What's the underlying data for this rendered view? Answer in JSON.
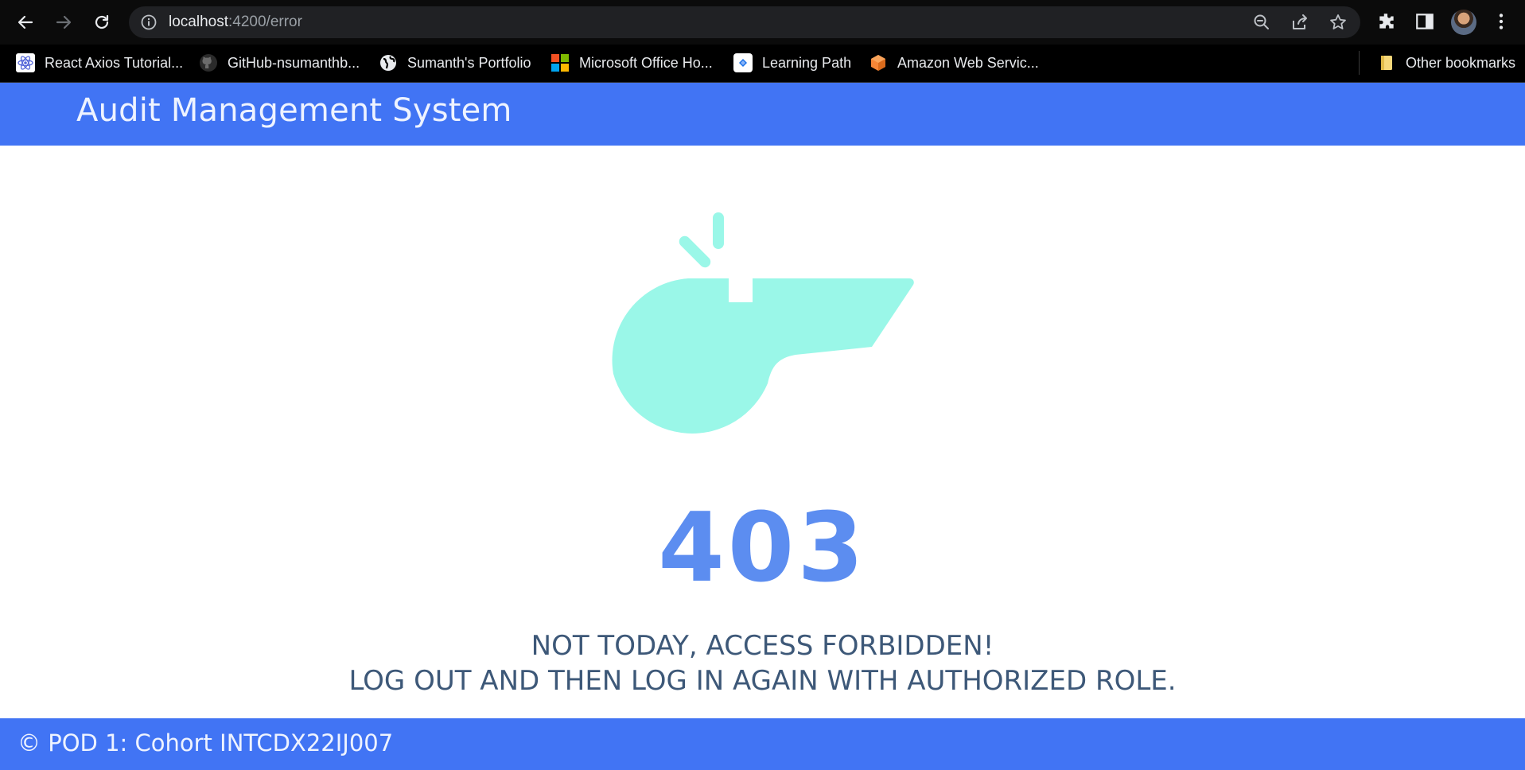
{
  "browser": {
    "url_host": "localhost",
    "url_path": ":4200/error",
    "bookmarks": [
      {
        "label": "React Axios Tutorial...",
        "icon": "react-icon"
      },
      {
        "label": "GitHub-nsumanthb...",
        "icon": "github-icon"
      },
      {
        "label": "Sumanth's Portfolio",
        "icon": "globe-icon"
      },
      {
        "label": "Microsoft Office Ho...",
        "icon": "microsoft-icon"
      },
      {
        "label": "Learning Path",
        "icon": "learning-path-icon"
      },
      {
        "label": "Amazon Web Servic...",
        "icon": "aws-icon"
      }
    ],
    "other_bookmarks": "Other bookmarks"
  },
  "header": {
    "title": "Audit Management System"
  },
  "error": {
    "code": "403",
    "line1": "NOT TODAY, ACCESS FORBIDDEN!",
    "line2": "LOG OUT AND THEN LOG IN AGAIN WITH AUTHORIZED ROLE.",
    "illustration_icon": "whistle-icon"
  },
  "footer": {
    "text": "© POD 1: Cohort INTCDX22IJ007"
  },
  "colors": {
    "primary": "#4174f4",
    "code": "#5c8df0",
    "message": "#3d5878",
    "whistle": "#9af7e8"
  }
}
